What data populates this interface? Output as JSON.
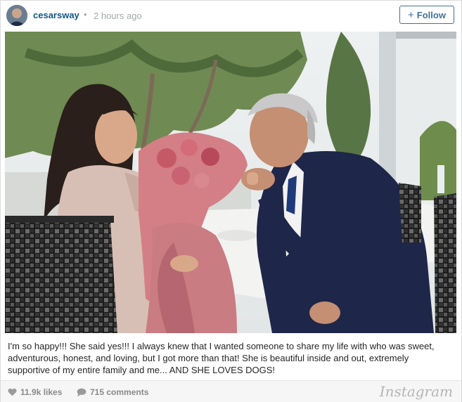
{
  "post": {
    "username": "cesarsway",
    "separator": "•",
    "time": "2 hours ago",
    "follow_label": "Follow",
    "follow_plus": "+"
  },
  "caption": {
    "text": "I'm so happy!!! She said yes!!! I always knew that I wanted someone to share my life with who was sweet, adventurous, honest, and loving, but I got more than that! She is beautiful inside and out, extremely supportive of my entire family and me... AND SHE LOVES DOGS!"
  },
  "footer": {
    "likes": "11.9k likes",
    "comments": "715 comments",
    "brand": "Instagram"
  },
  "colors": {
    "username": "#125688",
    "follow": "#3f729b",
    "muted": "#a5a7aa"
  },
  "icons": {
    "likes": "heart-icon",
    "comments": "speech-bubble-icon",
    "avatar": "profile-photo"
  }
}
